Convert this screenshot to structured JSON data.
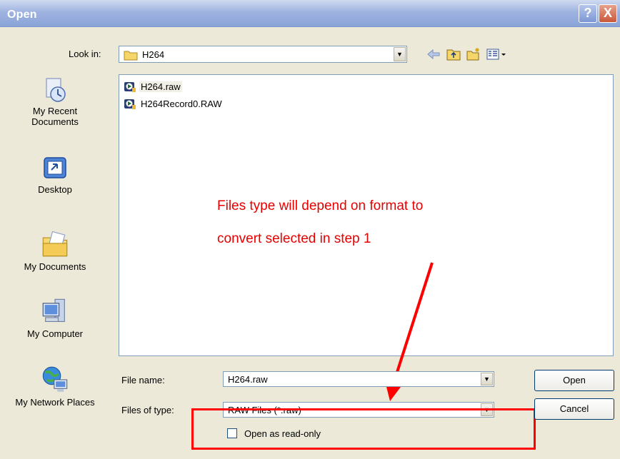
{
  "window": {
    "title": "Open",
    "help_label": "?",
    "close_label": "X"
  },
  "toolbar": {
    "look_in_label": "Look in:",
    "look_in_value": "H264",
    "icons": [
      "back-arrow-icon",
      "up-folder-icon",
      "new-folder-icon",
      "views-menu-icon"
    ]
  },
  "places": [
    {
      "label": "My Recent Documents",
      "icon": "recent-documents-icon"
    },
    {
      "label": "Desktop",
      "icon": "desktop-icon"
    },
    {
      "label": "My Documents",
      "icon": "my-documents-icon"
    },
    {
      "label": "My Computer",
      "icon": "my-computer-icon"
    },
    {
      "label": "My Network Places",
      "icon": "network-places-icon"
    }
  ],
  "files": [
    {
      "name": "H264.raw",
      "selected": true
    },
    {
      "name": "H264Record0.RAW",
      "selected": false
    }
  ],
  "annotation": {
    "line1": "Files type will depend on format to",
    "line2": "convert selected in step 1",
    "color": "#e80000"
  },
  "form": {
    "file_name_label": "File name:",
    "file_name_value": "H264.raw",
    "file_type_label": "Files of type:",
    "file_type_value": "RAW Files (*.raw)",
    "readonly_label": "Open as read-only"
  },
  "buttons": {
    "open": "Open",
    "cancel": "Cancel"
  }
}
